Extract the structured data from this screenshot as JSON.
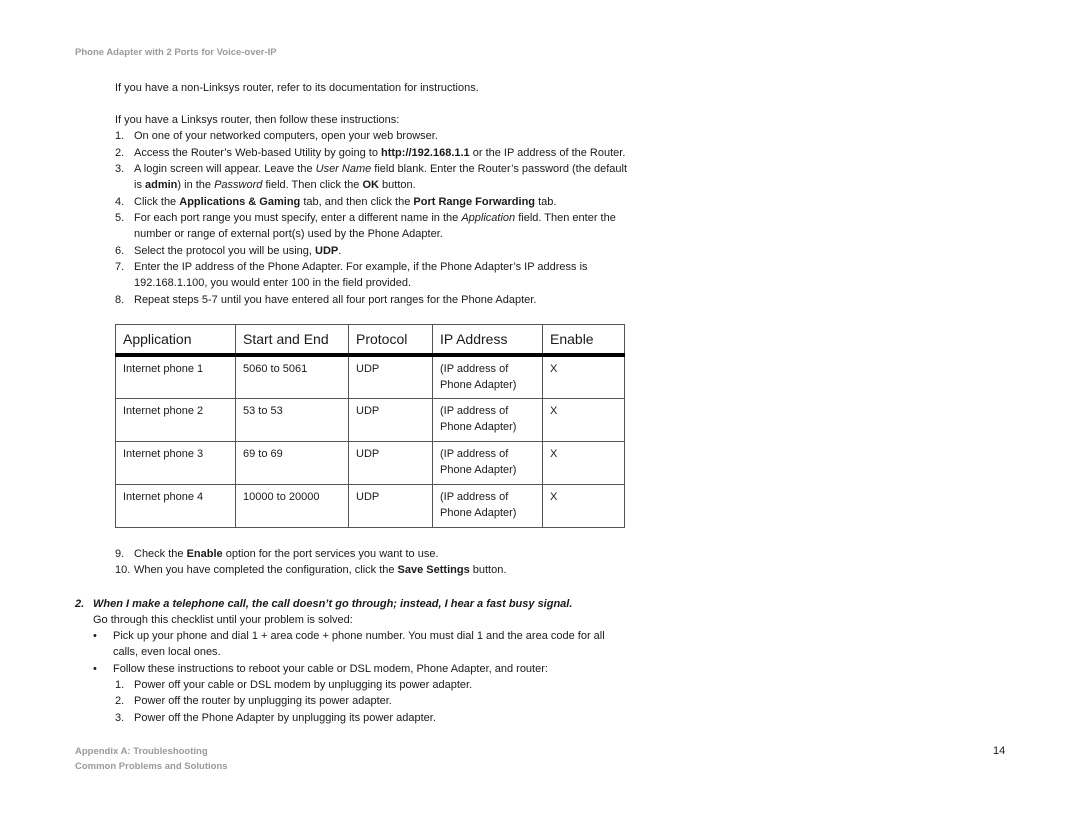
{
  "header": {
    "running_title": "Phone Adapter with 2 Ports for Voice-over-IP"
  },
  "intro": {
    "non_linksys": "If you have a non-Linksys router, refer to its documentation for instructions.",
    "linksys": "If you have a Linksys router, then follow these instructions:"
  },
  "steps": [
    {
      "n": "1.",
      "parts": [
        {
          "t": "On one of your networked computers, open your web browser."
        }
      ]
    },
    {
      "n": "2.",
      "parts": [
        {
          "t": "Access the Router’s Web-based Utility by going to "
        },
        {
          "t": "http://192.168.1.1",
          "b": true
        },
        {
          "t": " or the IP address of the Router."
        }
      ]
    },
    {
      "n": "3.",
      "parts": [
        {
          "t": "A login screen will appear. Leave the "
        },
        {
          "t": "User Name",
          "i": true
        },
        {
          "t": " field blank. Enter the Router’s password (the default"
        }
      ],
      "line2": [
        {
          "t": "is "
        },
        {
          "t": "admin",
          "b": true
        },
        {
          "t": ") in the "
        },
        {
          "t": "Password",
          "i": true
        },
        {
          "t": " field. Then click the "
        },
        {
          "t": "OK",
          "b": true
        },
        {
          "t": " button."
        }
      ]
    },
    {
      "n": "4.",
      "parts": [
        {
          "t": "Click the "
        },
        {
          "t": "Applications & Gaming",
          "b": true
        },
        {
          "t": " tab, and then click the "
        },
        {
          "t": "Port Range Forwarding",
          "b": true
        },
        {
          "t": " tab."
        }
      ]
    },
    {
      "n": "5.",
      "parts": [
        {
          "t": "For each port range you must specify, enter a different name in the "
        },
        {
          "t": "Application",
          "i": true
        },
        {
          "t": " field. Then enter the"
        }
      ],
      "line2": [
        {
          "t": "number or range of external port(s) used by the Phone Adapter."
        }
      ]
    },
    {
      "n": "6.",
      "parts": [
        {
          "t": "Select the protocol you will be using, "
        },
        {
          "t": "UDP",
          "b": true
        },
        {
          "t": "."
        }
      ]
    },
    {
      "n": "7.",
      "parts": [
        {
          "t": "Enter the IP address of the Phone Adapter. For example, if the Phone Adapter’s IP address is"
        }
      ],
      "line2": [
        {
          "t": "192.168.1.100, you would enter 100 in the field provided."
        }
      ]
    },
    {
      "n": "8.",
      "parts": [
        {
          "t": "Repeat steps 5-7 until you have entered all four port ranges for the Phone Adapter."
        }
      ]
    }
  ],
  "table": {
    "headers": [
      "Application",
      "Start and End",
      "Protocol",
      "IP Address",
      "Enable"
    ],
    "rows": [
      [
        "Internet phone 1",
        "5060 to 5061",
        "UDP",
        "(IP address of Phone Adapter)",
        "X"
      ],
      [
        "Internet phone 2",
        "53 to 53",
        "UDP",
        "(IP address of Phone Adapter)",
        "X"
      ],
      [
        "Internet phone 3",
        "69 to 69",
        "UDP",
        "(IP address of Phone Adapter)",
        "X"
      ],
      [
        "Internet phone 4",
        "10000 to 20000",
        "UDP",
        "(IP address of Phone Adapter)",
        "X"
      ]
    ]
  },
  "steps_after": [
    {
      "n": "9.",
      "parts": [
        {
          "t": "Check the "
        },
        {
          "t": "Enable",
          "b": true
        },
        {
          "t": " option for the port services you want to use."
        }
      ]
    },
    {
      "n": "10.",
      "parts": [
        {
          "t": "When you have completed the configuration, click the "
        },
        {
          "t": "Save Settings",
          "b": true
        },
        {
          "t": " button."
        }
      ]
    }
  ],
  "question2": {
    "number": "2.",
    "title": "When I make a telephone call, the call doesn’t go through; instead, I hear a fast busy signal.",
    "lead": "Go through this checklist until your problem is solved:",
    "bullets": [
      {
        "symbol": "•",
        "line1": "Pick up your phone and dial 1 + area code + phone number. You must dial 1 and the area code for all",
        "line2": "calls, even local ones."
      },
      {
        "symbol": "•",
        "line1": "Follow these instructions to reboot your cable or DSL modem, Phone Adapter, and router:"
      }
    ],
    "reboot_steps": [
      {
        "n": "1.",
        "text": "Power off your cable or DSL modem by unplugging its power adapter."
      },
      {
        "n": "2.",
        "text": "Power off the router by unplugging its power adapter."
      },
      {
        "n": "3.",
        "text": "Power off the Phone Adapter by unplugging its power adapter."
      }
    ]
  },
  "footer": {
    "line1": "Appendix A: Troubleshooting",
    "line2": "Common Problems and Solutions",
    "page_number": "14"
  }
}
